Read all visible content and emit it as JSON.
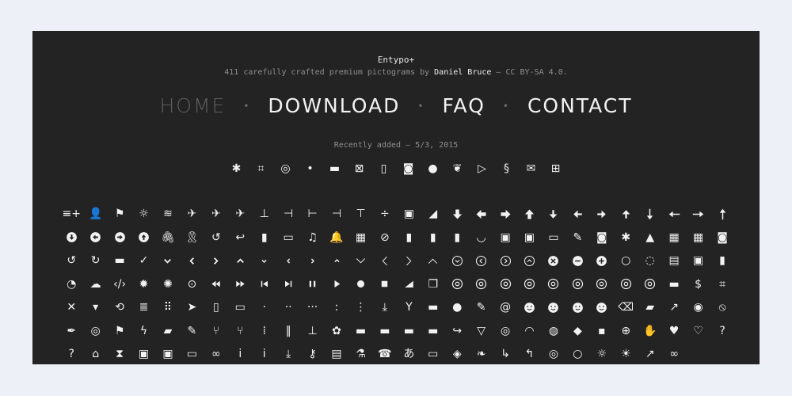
{
  "header": {
    "title": "Entypo+",
    "subtitle_pre": "411 carefully crafted premium pictograms by ",
    "author": "Daniel Bruce",
    "subtitle_post": " — CC BY-SA 4.0."
  },
  "nav": {
    "home": "HOME",
    "download": "DOWNLOAD",
    "faq": "FAQ",
    "contact": "CONTACT",
    "separator": "•"
  },
  "recent": {
    "label": "Recently added — 5/3, 2015",
    "icons": [
      "bug",
      "crop",
      "fingerprint",
      "cursor",
      "id-card",
      "camera-off",
      "devices",
      "video-camera",
      "apple",
      "paw",
      "google-play",
      "squarespace",
      "email-circle",
      "windows"
    ]
  },
  "grid_icons": [
    "add-to-list",
    "add-user",
    "address",
    "adjust",
    "air",
    "aircraft",
    "aircraft-landing",
    "aircraft-take-off",
    "align-bottom",
    "align-horizontal-middle",
    "align-left",
    "align-right",
    "align-top",
    "align-vertical-middle",
    "archive",
    "area-graph",
    "arrow-bold-down",
    "arrow-bold-left",
    "arrow-bold-right",
    "arrow-bold-up",
    "arrow-down",
    "arrow-left",
    "arrow-right",
    "arrow-up",
    "arrow-long-down",
    "arrow-long-left",
    "arrow-long-right",
    "arrow-long-up",
    "arrow-with-circle-down",
    "arrow-with-circle-left",
    "arrow-with-circle-right",
    "arrow-with-circle-up",
    "attachment",
    "awareness-ribbon",
    "back-in-time",
    "back",
    "bar-graph",
    "battery",
    "beamed-note",
    "bell",
    "blackboard",
    "block",
    "book",
    "bookmark",
    "bookmarks",
    "bowl",
    "box",
    "briefcase",
    "browser",
    "brush",
    "bucket",
    "bug",
    "cake",
    "calculator",
    "calendar",
    "camera",
    "ccw",
    "cw",
    "chat",
    "check",
    "chevron-down",
    "chevron-left",
    "chevron-right",
    "chevron-up",
    "chevron-small-down",
    "chevron-small-left",
    "chevron-small-right",
    "chevron-small-up",
    "chevron-thin-down",
    "chevron-thin-left",
    "chevron-thin-right",
    "chevron-thin-up",
    "chevron-with-circle-down",
    "chevron-with-circle-left",
    "chevron-with-circle-right",
    "chevron-with-circle-up",
    "circle-with-cross",
    "circle-with-minus",
    "circle-with-plus",
    "circle",
    "circular-graph",
    "clapperboard",
    "classic-computer",
    "clipboard",
    "clock",
    "cloud",
    "code",
    "cog",
    "colours",
    "compass",
    "controller-fast-backward",
    "controller-fast-forward",
    "controller-jump-to-start",
    "controller-next",
    "controller-paus",
    "controller-play",
    "controller-record",
    "controller-stop",
    "controller-volume",
    "copy",
    "creative-commons-attribution",
    "creative-commons",
    "creative-commons-noderivs",
    "creative-commons-noncommercial-eu",
    "creative-commons-noncommercial-us",
    "creative-commons-public-domain",
    "creative-commons-remix",
    "creative-commons-share",
    "creative-commons-sharealike",
    "credit-card",
    "credit",
    "crop",
    "cross",
    "cup",
    "cycle",
    "database",
    "dial-pad",
    "direction",
    "document",
    "documents",
    "dot-single",
    "dots-two-horizontal",
    "dots-three-horizontal",
    "dots-two-vertical",
    "dots-three-vertical",
    "download",
    "drink",
    "drive",
    "drop",
    "edit",
    "email",
    "emoji-flirt",
    "emoji-happy",
    "emoji-neutral",
    "emoji-sad",
    "erase",
    "eraser",
    "export",
    "eye",
    "eye-with-line",
    "feather",
    "fingerprint",
    "flag",
    "flash",
    "flashlight",
    "flat-brush",
    "flow-branch",
    "flow-cascade",
    "flow-line",
    "flow-parallel",
    "flow-tree",
    "flower",
    "folder",
    "folder-images",
    "folder-music",
    "folder-video",
    "forward",
    "funnel",
    "game-controller",
    "gauge",
    "globe",
    "graduation-cap",
    "grid",
    "hair-cross",
    "hand",
    "heart",
    "heart-outlined",
    "help",
    "help-with-circle",
    "home",
    "hour-glass",
    "image",
    "images",
    "inbox",
    "infinity",
    "info",
    "info-with-circle",
    "install",
    "key",
    "keyboard",
    "lab-flask",
    "landline",
    "language",
    "laptop",
    "layers",
    "leaf",
    "level-down",
    "level-up",
    "lifebuoy",
    "light-bulb",
    "light-down",
    "light-up",
    "line-graph",
    "link"
  ]
}
